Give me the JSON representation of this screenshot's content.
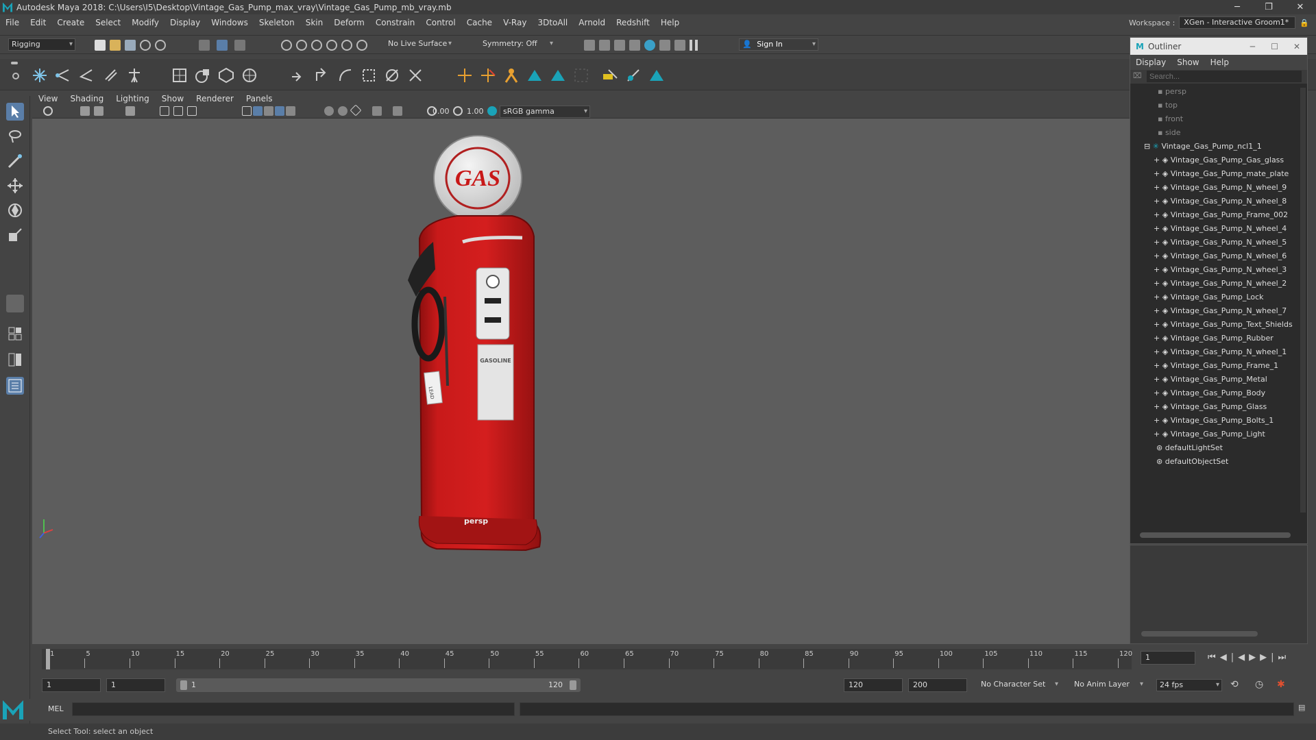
{
  "window": {
    "title": "Autodesk Maya 2018: C:\\Users\\I5\\Desktop\\Vintage_Gas_Pump_max_vray\\Vintage_Gas_Pump_mb_vray.mb",
    "minimize": "─",
    "maximize": "❐",
    "close": "✕"
  },
  "menubar": [
    "File",
    "Edit",
    "Create",
    "Select",
    "Modify",
    "Display",
    "Windows",
    "Skeleton",
    "Skin",
    "Deform",
    "Constrain",
    "Control",
    "Cache",
    "V-Ray",
    "3DtoAll",
    "Arnold",
    "Redshift",
    "Help"
  ],
  "workspace": {
    "label": "Workspace :",
    "value": "XGen - Interactive Groom1*"
  },
  "statusline": {
    "mode": "Rigging",
    "live_surface": "No Live Surface",
    "symmetry": "Symmetry: Off",
    "sign_in": "Sign In"
  },
  "viewport": {
    "menu": [
      "View",
      "Shading",
      "Lighting",
      "Show",
      "Renderer",
      "Panels"
    ],
    "exposure": "0.00",
    "gamma": "1.00",
    "colorspace": "sRGB gamma",
    "camera_label": "persp",
    "pump": {
      "globe_text": "GAS",
      "panel_text": "GASOLINE",
      "sticker_text": "LEAD"
    }
  },
  "outliner": {
    "title": "Outliner",
    "menu": [
      "Display",
      "Show",
      "Help"
    ],
    "search_placeholder": "Search...",
    "cameras": [
      "persp",
      "top",
      "front",
      "side"
    ],
    "group": "Vintage_Gas_Pump_ncl1_1",
    "children": [
      "Vintage_Gas_Pump_Gas_glass",
      "Vintage_Gas_Pump_mate_plate",
      "Vintage_Gas_Pump_N_wheel_9",
      "Vintage_Gas_Pump_N_wheel_8",
      "Vintage_Gas_Pump_Frame_002",
      "Vintage_Gas_Pump_N_wheel_4",
      "Vintage_Gas_Pump_N_wheel_5",
      "Vintage_Gas_Pump_N_wheel_6",
      "Vintage_Gas_Pump_N_wheel_3",
      "Vintage_Gas_Pump_N_wheel_2",
      "Vintage_Gas_Pump_Lock",
      "Vintage_Gas_Pump_N_wheel_7",
      "Vintage_Gas_Pump_Text_Shields",
      "Vintage_Gas_Pump_Rubber",
      "Vintage_Gas_Pump_N_wheel_1",
      "Vintage_Gas_Pump_Frame_1",
      "Vintage_Gas_Pump_Metal",
      "Vintage_Gas_Pump_Body",
      "Vintage_Gas_Pump_Glass",
      "Vintage_Gas_Pump_Bolts_1",
      "Vintage_Gas_Pump_Light"
    ],
    "sets": [
      "defaultLightSet",
      "defaultObjectSet"
    ]
  },
  "timeline": {
    "ticks": [
      "1",
      "5",
      "10",
      "15",
      "20",
      "25",
      "30",
      "35",
      "40",
      "45",
      "50",
      "55",
      "60",
      "65",
      "70",
      "75",
      "80",
      "85",
      "90",
      "95",
      "100",
      "105",
      "110",
      "115",
      "120"
    ],
    "current_frame": "1"
  },
  "range": {
    "start": "1",
    "inner_start": "1",
    "slider_start": "1",
    "slider_end": "120",
    "end": "120",
    "outer_end": "200",
    "character_set": "No Character Set",
    "anim_layer": "No Anim Layer",
    "fps": "24 fps"
  },
  "cmdline": {
    "lang": "MEL"
  },
  "helpline": {
    "text": "Select Tool: select an object"
  }
}
